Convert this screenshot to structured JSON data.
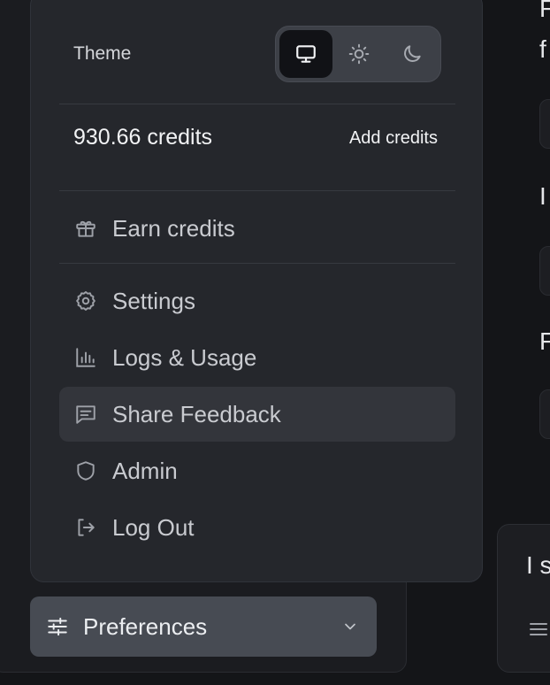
{
  "theme": {
    "label": "Theme",
    "options": [
      "system",
      "light",
      "dark"
    ],
    "selected": "system"
  },
  "credits": {
    "balance": "930.66 credits",
    "add_label": "Add credits"
  },
  "menu": {
    "earn": "Earn credits",
    "settings": "Settings",
    "logs": "Logs & Usage",
    "feedback": "Share Feedback",
    "admin": "Admin",
    "logout": "Log Out"
  },
  "preferences": {
    "label": "Preferences"
  },
  "background": {
    "fragments": [
      "F",
      "f",
      "I",
      "F"
    ],
    "card_fragment": "I s"
  }
}
